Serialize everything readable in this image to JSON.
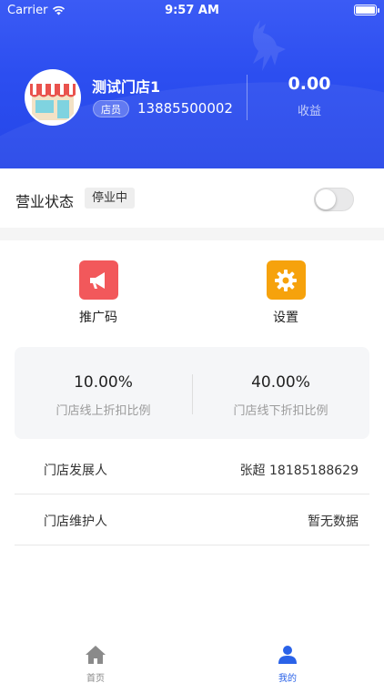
{
  "status_bar": {
    "carrier": "Carrier",
    "time": "9:57 AM"
  },
  "profile": {
    "store_name": "测试门店1",
    "role": "店员",
    "phone": "13885500002",
    "earnings_value": "0.00",
    "earnings_label": "收益"
  },
  "business": {
    "label": "营业状态",
    "status": "停业中",
    "toggle_on": false
  },
  "actions": [
    {
      "label": "推广码",
      "icon": "megaphone-icon",
      "color": "#f2585b"
    },
    {
      "label": "设置",
      "icon": "gear-icon",
      "color": "#f6a20c"
    }
  ],
  "ratios": [
    {
      "value": "10.00%",
      "label": "门店线上折扣比例"
    },
    {
      "value": "40.00%",
      "label": "门店线下折扣比例"
    }
  ],
  "info": [
    {
      "key": "门店发展人",
      "value": "张超 18185188629"
    },
    {
      "key": "门店维护人",
      "value": "暂无数据"
    }
  ],
  "tabs": [
    {
      "label": "首页",
      "icon": "home-icon",
      "active": false
    },
    {
      "label": "我的",
      "icon": "user-icon",
      "active": true
    }
  ],
  "colors": {
    "primary": "#2c4ef0",
    "tab_active": "#2a62e8",
    "tab_inactive": "#888888"
  }
}
